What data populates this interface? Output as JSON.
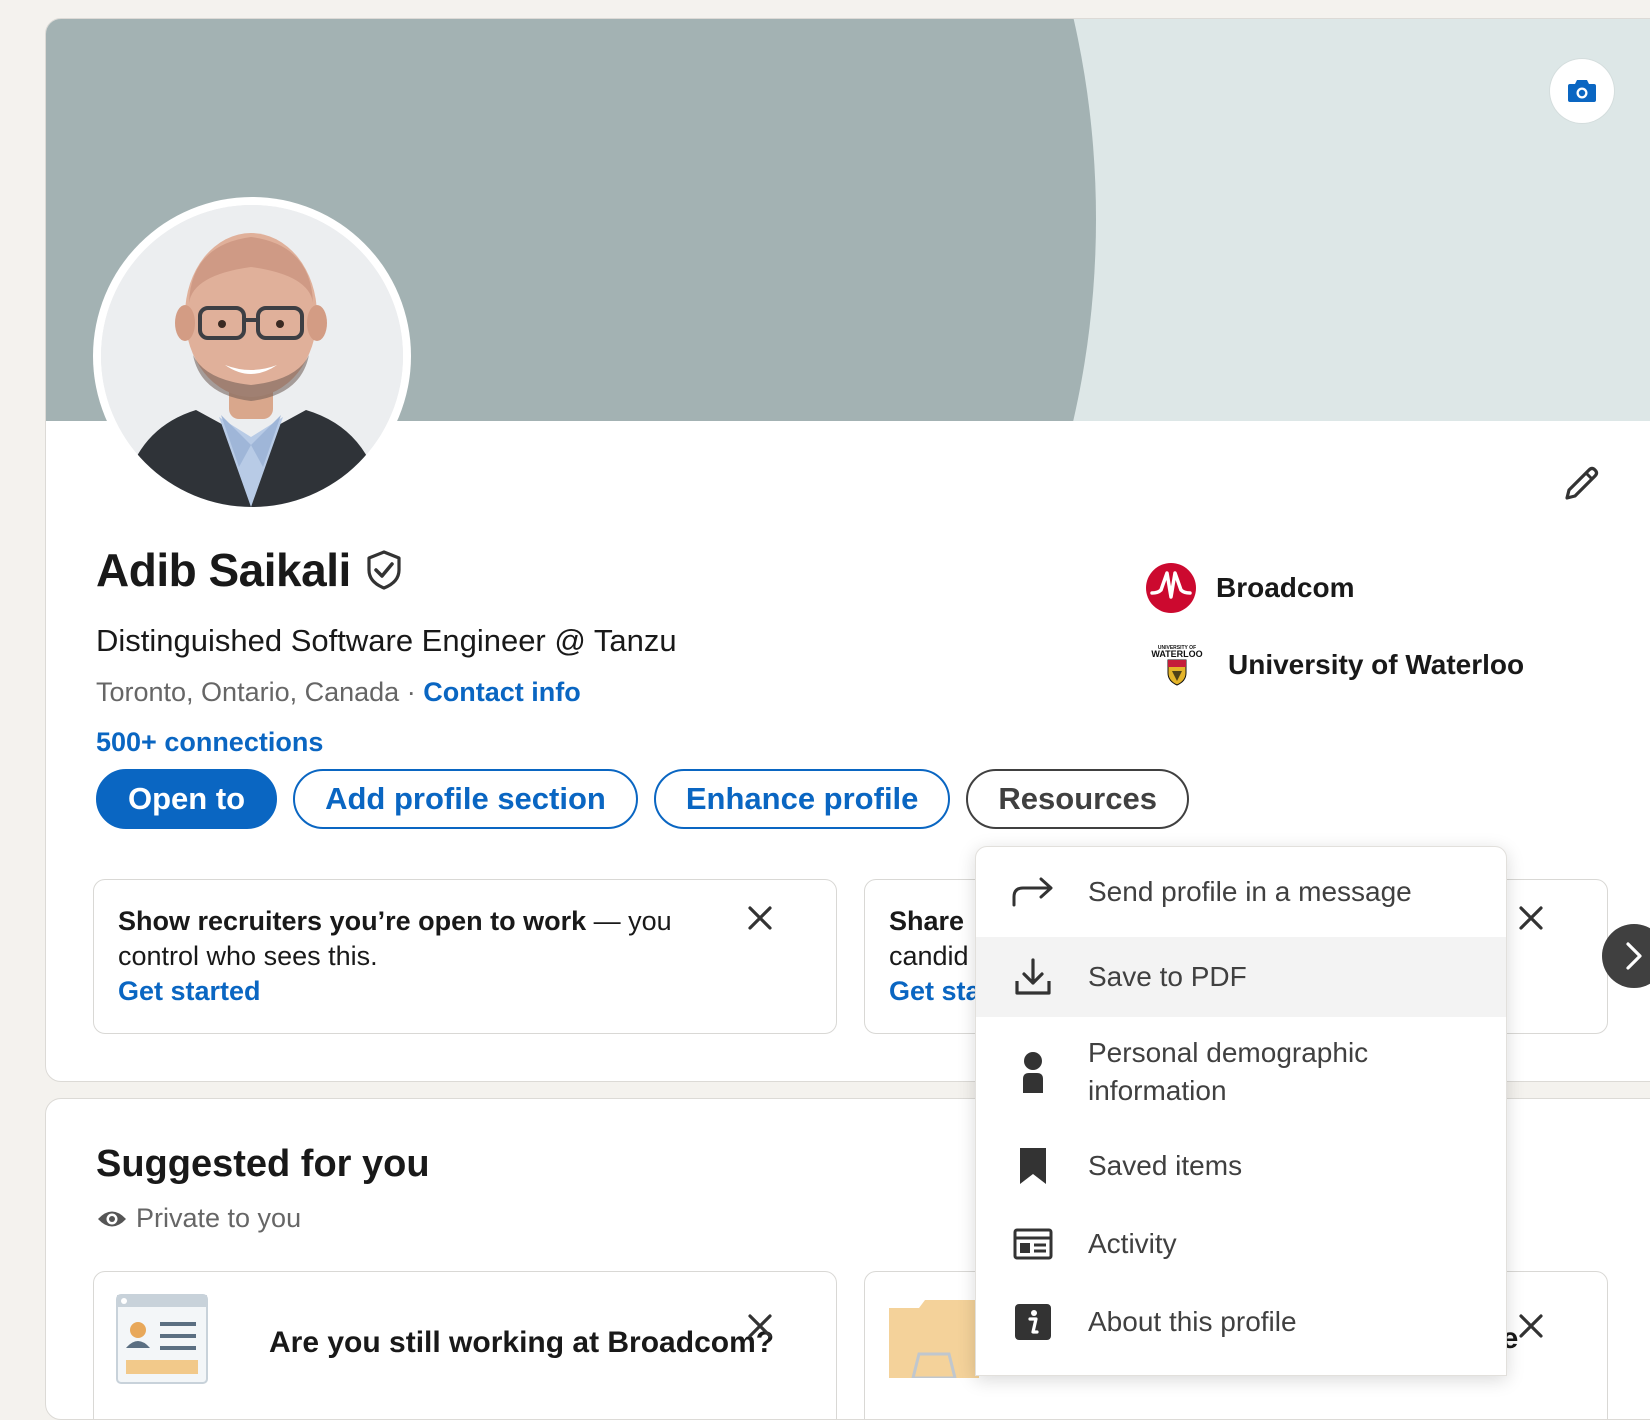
{
  "profile": {
    "name": "Adib Saikali",
    "headline": "Distinguished Software Engineer @ Tanzu",
    "location": "Toronto, Ontario, Canada",
    "separator": "·",
    "contact_info": "Contact info",
    "connections": "500+ connections",
    "organizations": [
      {
        "name": "Broadcom",
        "logo": "broadcom-logo"
      },
      {
        "name": "University of Waterloo",
        "logo": "waterloo-logo",
        "logo_text": "UNIVERSITY OF WATERLOO"
      }
    ]
  },
  "actions": {
    "open_to": "Open to",
    "add_profile_section": "Add profile section",
    "enhance_profile": "Enhance profile",
    "resources": "Resources"
  },
  "recommendations": [
    {
      "title": "Show recruiters you’re open to work",
      "rest": " — you control who sees this.",
      "cta": "Get started"
    },
    {
      "title_partial": "Share",
      "line2_partial": "candid",
      "cta_partial": "Get sta"
    }
  ],
  "suggested": {
    "title": "Suggested for you",
    "privacy": "Private to you",
    "card1_question": "Are you still working at Broadcom?",
    "card2_partial": "se"
  },
  "resources_menu": {
    "items": [
      {
        "label": "Send profile in a message",
        "icon": "share-arrow-icon"
      },
      {
        "label": "Save to PDF",
        "icon": "download-icon"
      },
      {
        "label": "Personal demographic information",
        "icon": "person-icon"
      },
      {
        "label": "Saved items",
        "icon": "bookmark-icon"
      },
      {
        "label": "Activity",
        "icon": "activity-feed-icon"
      },
      {
        "label": "About this profile",
        "icon": "info-icon"
      }
    ]
  },
  "colors": {
    "brand_blue": "#0a66c2",
    "broadcom_red": "#cc092f",
    "cover_gray": "#a3b2b3"
  }
}
